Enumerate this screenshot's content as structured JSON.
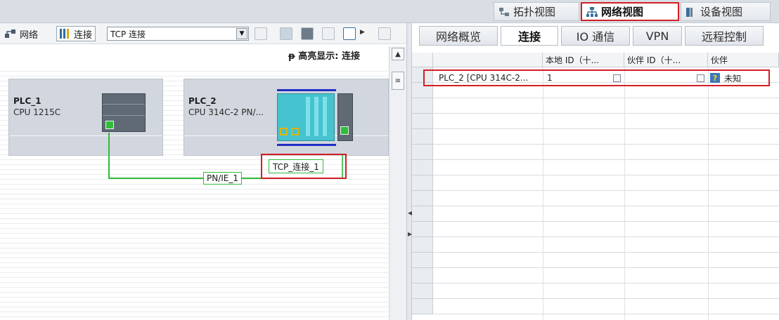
{
  "view_tabs": [
    {
      "label": "拓扑视图",
      "icon": "topology-icon"
    },
    {
      "label": "网络视图",
      "icon": "network-icon"
    },
    {
      "label": "设备视图",
      "icon": "device-icon"
    }
  ],
  "toolbar": {
    "network_label": "网络",
    "connections_label": "连接",
    "connection_type_value": "TCP 连接"
  },
  "canvas": {
    "highlight_label": "高亮显示: 连接",
    "devices": [
      {
        "name": "PLC_1",
        "type": "CPU 1215C"
      },
      {
        "name": "PLC_2",
        "type": "CPU 314C-2 PN/..."
      }
    ],
    "subnet_label": "PN/IE_1",
    "connection_label": "TCP_连接_1"
  },
  "right_tabs": [
    {
      "label": "网络概览"
    },
    {
      "label": "连接"
    },
    {
      "label": "IO 通信"
    },
    {
      "label": "VPN"
    },
    {
      "label": "远程控制"
    }
  ],
  "table": {
    "headers": [
      "",
      "本地 ID（十...",
      "伙伴 ID（十...",
      "伙伴"
    ],
    "rows": [
      {
        "local": "PLC_2 [CPU 314C-2...",
        "local_id": "1",
        "partner_id": "",
        "partner": "未知"
      }
    ]
  },
  "colors": {
    "highlight_red": "#d21e26",
    "subnet_green": "#2ebd3a",
    "device_gray": "#d2d6de",
    "profinet_blue": "#1f2fc4"
  }
}
